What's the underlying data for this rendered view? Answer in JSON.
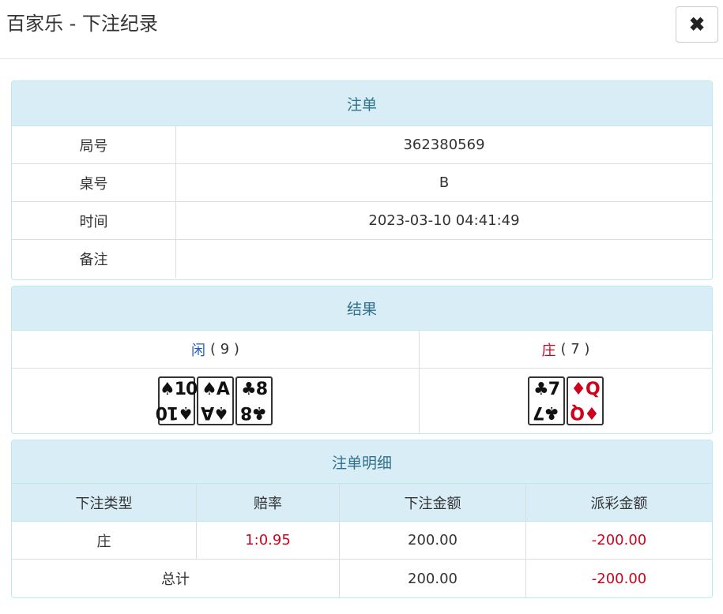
{
  "header": {
    "title": "百家乐 - 下注纪录",
    "close_icon": "✖"
  },
  "order": {
    "heading": "注单",
    "rows": [
      {
        "label": "局号",
        "value": "362380569"
      },
      {
        "label": "桌号",
        "value": "B"
      },
      {
        "label": "时间",
        "value": "2023-03-10 04:41:49"
      },
      {
        "label": "备注",
        "value": ""
      }
    ]
  },
  "result": {
    "heading": "结果",
    "player": {
      "label": "闲",
      "score": "( 9 )",
      "cards": [
        {
          "rank": "10",
          "suit": "♠",
          "color": "black"
        },
        {
          "rank": "A",
          "suit": "♠",
          "color": "black"
        },
        {
          "rank": "8",
          "suit": "♣",
          "color": "black"
        }
      ]
    },
    "banker": {
      "label": "庄",
      "score": "( 7 )",
      "cards": [
        {
          "rank": "7",
          "suit": "♣",
          "color": "black"
        },
        {
          "rank": "Q",
          "suit": "♦",
          "color": "red"
        }
      ]
    },
    "colors": {
      "player": "#1f5fbf",
      "banker": "#d0021b"
    }
  },
  "detail": {
    "heading": "注单明细",
    "columns": [
      "下注类型",
      "赔率",
      "下注金额",
      "派彩金额"
    ],
    "rows": [
      {
        "type": "庄",
        "odds": "1:0.95",
        "amount": "200.00",
        "payout": "-200.00"
      }
    ],
    "total": {
      "label": "总计",
      "amount": "200.00",
      "payout": "-200.00"
    }
  }
}
